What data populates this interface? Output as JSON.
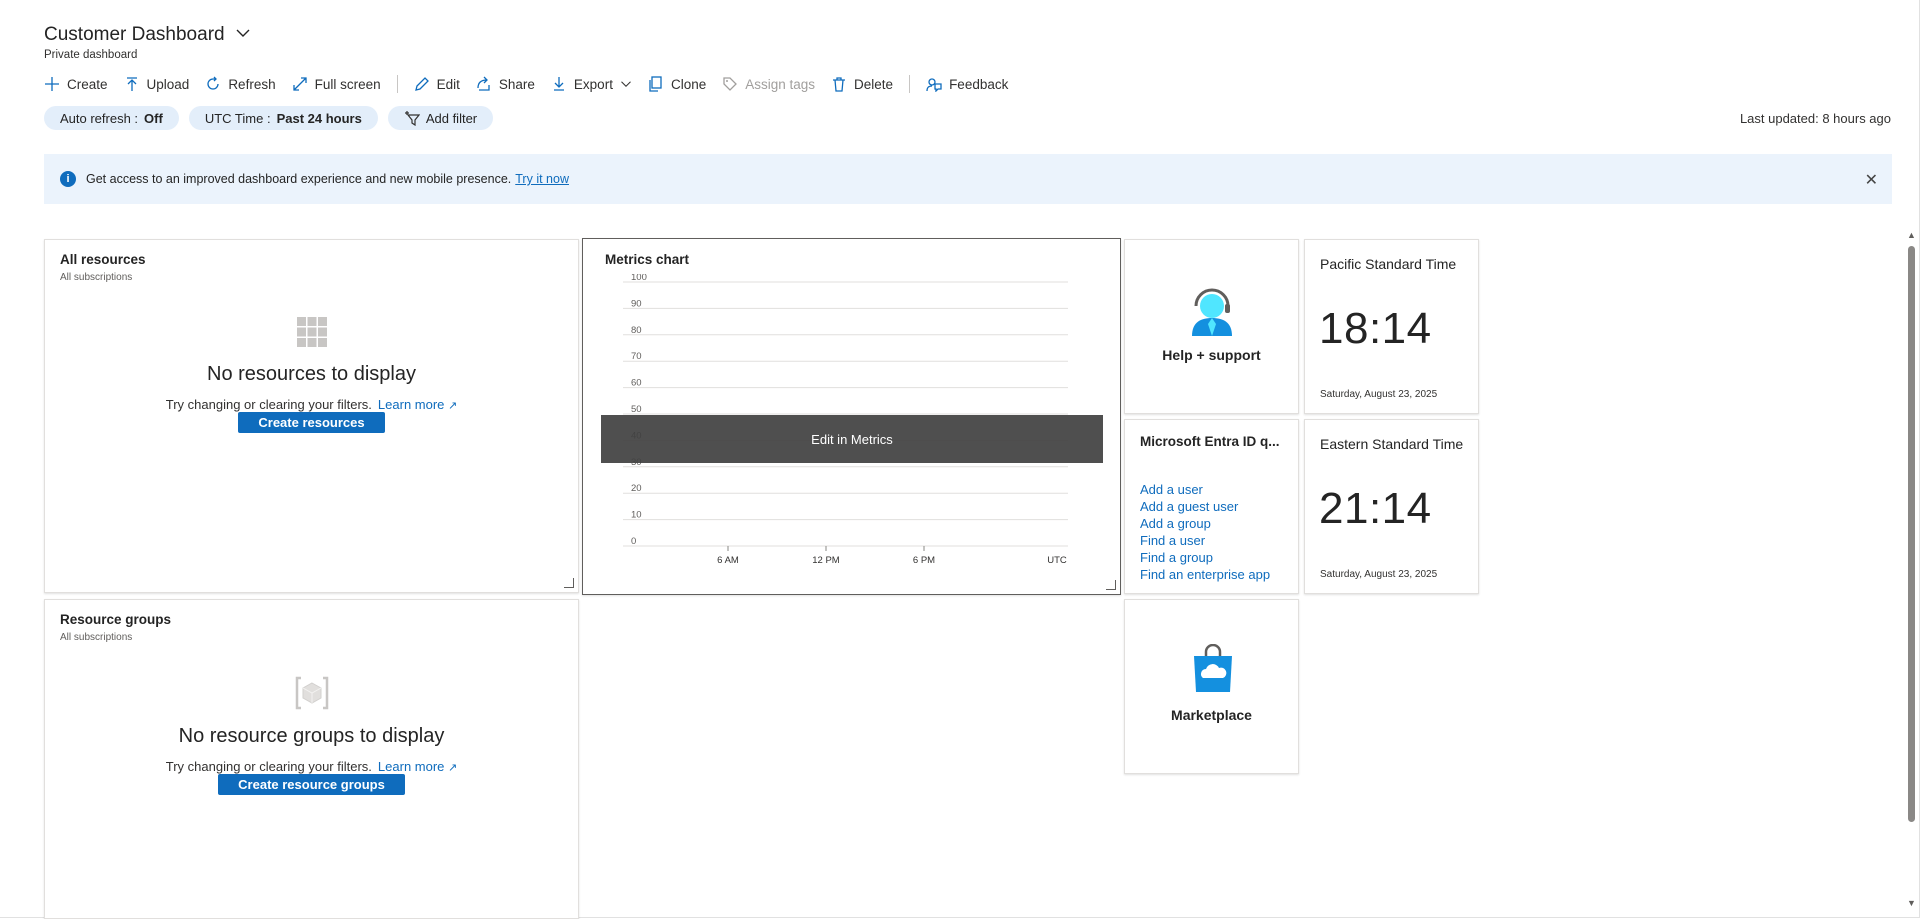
{
  "header": {
    "title": "Customer Dashboard",
    "subtitle": "Private dashboard"
  },
  "toolbar": {
    "create": "Create",
    "upload": "Upload",
    "refresh": "Refresh",
    "fullscreen": "Full screen",
    "edit": "Edit",
    "share": "Share",
    "export": "Export",
    "clone": "Clone",
    "assign_tags": "Assign tags",
    "delete": "Delete",
    "feedback": "Feedback"
  },
  "filters": {
    "auto_refresh_label": "Auto refresh : ",
    "auto_refresh_value": "Off",
    "time_label": "UTC Time : ",
    "time_value": "Past 24 hours",
    "add_filter": "Add filter"
  },
  "last_updated": "Last updated: 8 hours ago",
  "banner": {
    "text": "Get access to an improved dashboard experience and new mobile presence.",
    "link": "Try it now"
  },
  "tiles": {
    "all_resources": {
      "title": "All resources",
      "sub": "All subscriptions",
      "empty_title": "No resources to display",
      "empty_text": "Try changing or clearing your filters.",
      "learn_more": "Learn more",
      "button": "Create resources"
    },
    "metrics": {
      "title": "Metrics chart",
      "overlay": "Edit in Metrics"
    },
    "help": {
      "label": "Help + support"
    },
    "pacific": {
      "title": "Pacific Standard Time",
      "time": "18:14",
      "date": "Saturday, August 23, 2025"
    },
    "eastern": {
      "title": "Eastern Standard Time",
      "time": "21:14",
      "date": "Saturday, August 23, 2025"
    },
    "entra": {
      "title": "Microsoft Entra ID q...",
      "links": [
        "Add a user",
        "Add a guest user",
        "Add a group",
        "Find a user",
        "Find a group",
        "Find an enterprise app"
      ]
    },
    "resource_groups": {
      "title": "Resource groups",
      "sub": "All subscriptions",
      "empty_title": "No resource groups to display",
      "empty_text": "Try changing or clearing your filters.",
      "learn_more": "Learn more",
      "button": "Create resource groups"
    },
    "marketplace": {
      "label": "Marketplace"
    }
  },
  "chart_data": {
    "type": "line",
    "title": "Metrics chart",
    "y_ticks": [
      "100",
      "90",
      "80",
      "70",
      "60",
      "50",
      "40",
      "30",
      "20",
      "10",
      "0"
    ],
    "x_ticks": [
      "6 AM",
      "12 PM",
      "6 PM",
      "UTC"
    ],
    "ylim": [
      0,
      100
    ],
    "series": [],
    "grid": true
  },
  "colors": {
    "accent": "#0f6cbd",
    "banner_bg": "#ebf3fc",
    "pill_bg": "#e3eefa"
  }
}
